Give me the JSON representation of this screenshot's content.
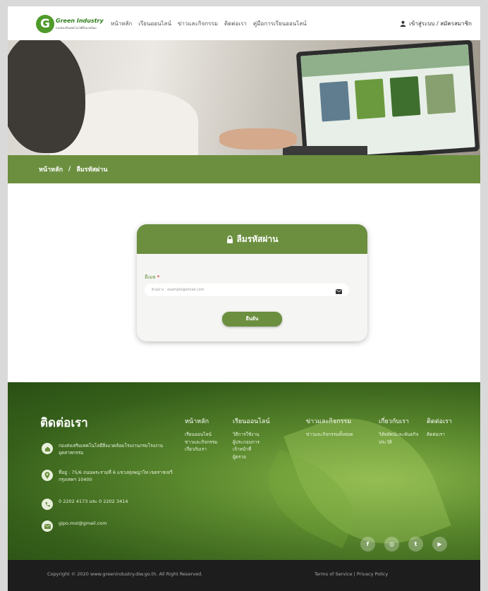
{
  "header": {
    "logo_letter": "G",
    "logo_title": "Green Industry",
    "logo_sub": "กองส่งเสริมเทคโนโลยีสิ่งแวดล้อม",
    "nav": [
      "หน้าหลัก",
      "เรียนออนไลน์",
      "ข่าวและกิจกรรม",
      "ติดต่อเรา",
      "คู่มือการเรียนออนไลน์"
    ],
    "login": "เข้าสู่ระบบ / สมัครสมาชิก",
    "login_icon": "user-icon"
  },
  "breadcrumb": {
    "home": "หน้าหลัก",
    "sep": "/",
    "current": "ลืมรหัสผ่าน"
  },
  "form": {
    "title": "ลืมรหัสผ่าน",
    "title_icon": "lock-icon",
    "email_label": "อีเมล",
    "required_mark": "*",
    "email_placeholder": "ตัวอย่าง : example@email.com",
    "email_icon": "envelope-icon",
    "submit": "ยืนยัน"
  },
  "footer": {
    "contact_title": "ติดต่อเรา",
    "contacts": [
      {
        "icon": "home-icon",
        "text": "กองส่งเสริมเทคโนโลยีสิ่งแวดล้อมโรงงานกรมโรงงานอุตสาหกรรม"
      },
      {
        "icon": "location-icon",
        "text": "ที่อยู่ : 75/6 ถนนพระรามที่ 6 แขวงทุ่งพญาไท เขตราชเทวี กรุงเทพฯ 10400"
      },
      {
        "icon": "phone-icon",
        "text": "0 2202 4173 และ 0 2202 3414"
      },
      {
        "icon": "email-icon",
        "text": "gipo.moi@gmail.com"
      }
    ],
    "columns": [
      {
        "title": "หน้าหลัก",
        "links": [
          "เรียนออนไลน์",
          "ข่าวและกิจกรรม",
          "เกี่ยวกับเรา"
        ]
      },
      {
        "title": "เรียนออนไลน์",
        "links": [
          "วิธีการใช้งาน",
          "ผู้ประกอบการ",
          "เจ้าหน้าที่",
          "ผู้ตรวจ"
        ]
      },
      {
        "title": "ข่าวและกิจกรรม",
        "links": [
          "ข่าวและกิจกรรมทั้งหมด"
        ]
      },
      {
        "title": "เกี่ยวกับเรา",
        "links": [
          "วิสัยทัศน์และพันธกิจ",
          "ประวัติ"
        ]
      },
      {
        "title": "ติดต่อเรา",
        "links": [
          "ติดต่อเรา"
        ]
      }
    ],
    "socials": [
      {
        "name": "facebook-icon",
        "glyph": "f"
      },
      {
        "name": "instagram-icon",
        "glyph": "◎"
      },
      {
        "name": "twitter-icon",
        "glyph": "t"
      },
      {
        "name": "youtube-icon",
        "glyph": "▶"
      }
    ],
    "copyright": "Copyright © 2020 www.greenindustry.diw.go.th. All Right Reserved.",
    "policy": "Terms of Service | Privacy Policy"
  },
  "colors": {
    "brand_green": "#6b8f3f",
    "required": "#dd0000",
    "footer_bottom": "#1d1d1d"
  }
}
